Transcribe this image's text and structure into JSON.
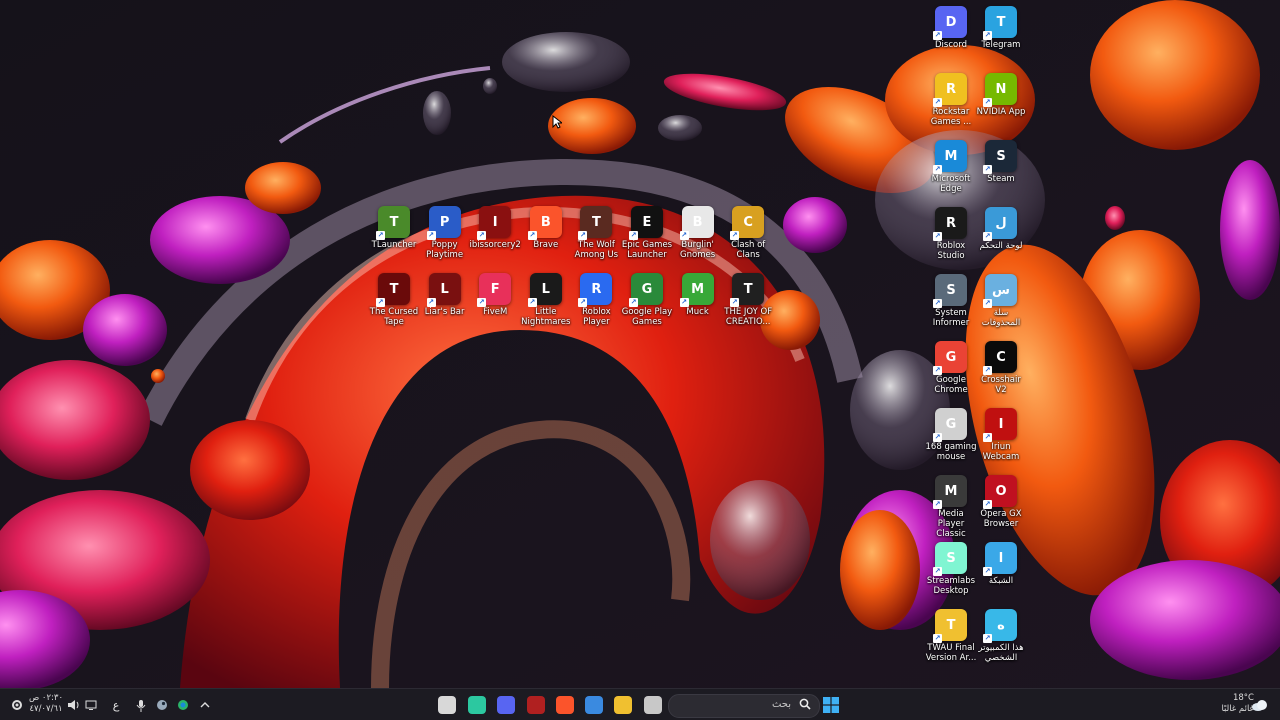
{
  "desktop": {
    "row1_icons": [
      {
        "label": "TLauncher",
        "icon": "tlauncher-icon",
        "color": "#4a8a2a"
      },
      {
        "label": "Poppy Playtime",
        "icon": "poppy-playtime-icon",
        "color": "#2a5cc8"
      },
      {
        "label": "ibissorcery2",
        "icon": "ibissorcery-icon",
        "color": "#8a1010"
      },
      {
        "label": "Brave",
        "icon": "brave-icon",
        "color": "#fb542b"
      },
      {
        "label": "The Wolf Among Us",
        "icon": "wolf-among-us-icon",
        "color": "#5a2a20"
      },
      {
        "label": "Epic Games Launcher",
        "icon": "epic-games-icon",
        "color": "#111111"
      },
      {
        "label": "Burglin' Gnomes",
        "icon": "burglin-gnomes-icon",
        "color": "#e8e8e8"
      },
      {
        "label": "Clash of Clans",
        "icon": "clash-of-clans-icon",
        "color": "#d8a020"
      }
    ],
    "row2_icons": [
      {
        "label": "The Cursed Tape",
        "icon": "cursed-tape-icon",
        "color": "#6a0a0a"
      },
      {
        "label": "Liar's Bar",
        "icon": "liars-bar-icon",
        "color": "#7a1010"
      },
      {
        "label": "FiveM",
        "icon": "fivem-icon",
        "color": "#e8305a"
      },
      {
        "label": "Little Nightmares",
        "icon": "little-nightmares-icon",
        "color": "#1a1a1a"
      },
      {
        "label": "Roblox Player",
        "icon": "roblox-player-icon",
        "color": "#2a6af0"
      },
      {
        "label": "Google Play Games",
        "icon": "google-play-games-icon",
        "color": "#2a8a3a"
      },
      {
        "label": "Muck",
        "icon": "muck-icon",
        "color": "#38a838"
      },
      {
        "label": "THE JOY OF CREATIO...",
        "icon": "joy-of-creation-icon",
        "color": "#202020"
      }
    ],
    "right_column_icons": [
      {
        "label": "Discord",
        "icon": "discord-icon",
        "color": "#5865f2"
      },
      {
        "label": "Telegram",
        "icon": "telegram-icon",
        "color": "#2aa3e0"
      },
      {
        "label": "Rockstar Games ...",
        "icon": "rockstar-games-icon",
        "color": "#f0c020"
      },
      {
        "label": "NVIDIA App",
        "icon": "nvidia-app-icon",
        "color": "#76b900"
      },
      {
        "label": "Microsoft Edge",
        "icon": "edge-icon",
        "color": "#1a8ad8"
      },
      {
        "label": "Steam",
        "icon": "steam-icon",
        "color": "#1b2838"
      },
      {
        "label": "Roblox Studio",
        "icon": "roblox-studio-icon",
        "color": "#1a1a1a"
      },
      {
        "label": "لوحة التحكم",
        "icon": "control-panel-icon",
        "color": "#3a9ad8"
      },
      {
        "label": "System Informer",
        "icon": "system-informer-icon",
        "color": "#5a6a7a"
      },
      {
        "label": "سلة المحذوفات",
        "icon": "recycle-bin-icon",
        "color": "#6ab0e0"
      },
      {
        "label": "Google Chrome",
        "icon": "chrome-icon",
        "color": "#ea4335"
      },
      {
        "label": "Crosshair V2",
        "icon": "crosshair-icon",
        "color": "#0a0a0a"
      },
      {
        "label": "168 gaming mouse",
        "icon": "gaming-mouse-icon",
        "color": "#d0d0d0"
      },
      {
        "label": "Iriun Webcam",
        "icon": "iriun-webcam-icon",
        "color": "#c01010"
      },
      {
        "label": "Media Player Classic",
        "icon": "media-player-classic-icon",
        "color": "#3a3a3a"
      },
      {
        "label": "Opera GX Browser",
        "icon": "opera-gx-icon",
        "color": "#c01020"
      },
      {
        "label": "Streamlabs Desktop",
        "icon": "streamlabs-icon",
        "color": "#80f5d2"
      },
      {
        "label": "الشبكة",
        "icon": "network-icon",
        "color": "#3aa8e8"
      },
      {
        "label": "TWAU Final Version Ar...",
        "icon": "folder-icon",
        "color": "#f0c030"
      },
      {
        "label": "هذا الكمبيوتر الشخصي",
        "icon": "this-pc-icon",
        "color": "#38b8e8"
      }
    ]
  },
  "taskbar": {
    "search_placeholder": "بحث",
    "clock_time": "٠٢:٣٠ ص",
    "clock_date": "٤٧/٠٧/٦١",
    "weather_temp": "18°C",
    "weather_desc": "غائم غالبًا",
    "language": "ع",
    "pinned": [
      {
        "name": "mouse-app-icon",
        "color": "#d8d8d8"
      },
      {
        "name": "streamlabs-taskbar-icon",
        "color": "#2cc8a0"
      },
      {
        "name": "discord-taskbar-icon",
        "color": "#5865f2"
      },
      {
        "name": "voicemod-taskbar-icon",
        "color": "#b02020"
      },
      {
        "name": "brave-taskbar-icon",
        "color": "#fb542b"
      },
      {
        "name": "store-taskbar-icon",
        "color": "#3a8ae0"
      },
      {
        "name": "file-explorer-taskbar-icon",
        "color": "#f0c030"
      },
      {
        "name": "app-taskbar-icon",
        "color": "#c8c8c8"
      }
    ]
  }
}
